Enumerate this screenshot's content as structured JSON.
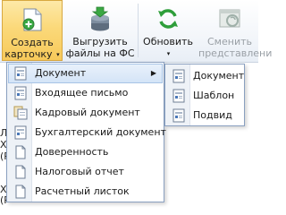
{
  "ribbon": {
    "create": {
      "line1": "Создать",
      "line2": "карточку",
      "caret": "▾"
    },
    "export": {
      "line1": "Выгрузить",
      "line2": "файлы на ФС"
    },
    "refresh": {
      "line1": "Обновить",
      "caret": "▾"
    },
    "change_view": {
      "line1": "Сменить",
      "line2": "представлени"
    }
  },
  "background_text": [
    "Л",
    "Х",
    "(Р",
    "Х",
    "(Р"
  ],
  "create_menu": {
    "items": [
      {
        "label": "Документ",
        "icon": "document-icon",
        "has_submenu": true
      },
      {
        "label": "Входящее письмо",
        "icon": "document-icon"
      },
      {
        "label": "Кадровый документ",
        "icon": "copy-documents-icon"
      },
      {
        "label": "Бухгалтерский документ",
        "icon": "document-icon"
      },
      {
        "label": "Доверенность",
        "icon": "blank-document-icon"
      },
      {
        "label": "Налоговый отчет",
        "icon": "blank-document-icon"
      },
      {
        "label": "Расчетный листок",
        "icon": "blank-document-icon"
      }
    ],
    "submenu_arrow": "▶"
  },
  "document_submenu": {
    "items": [
      {
        "label": "Документ",
        "icon": "document-icon"
      },
      {
        "label": "Шаблон",
        "icon": "document-icon"
      },
      {
        "label": "Подвид",
        "icon": "document-icon"
      }
    ]
  }
}
